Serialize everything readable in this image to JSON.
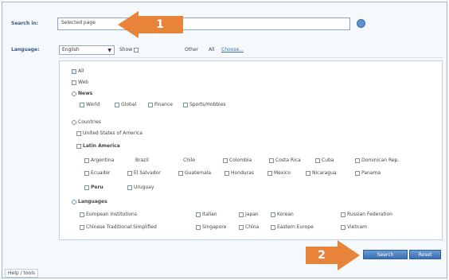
{
  "search": {
    "label": "Search in:",
    "value": "Selected page"
  },
  "language": {
    "label": "Language:",
    "selected": "English",
    "checkbox_label": "Show",
    "other_label": "Other",
    "other_value": "All",
    "other_link": "Choose..."
  },
  "options": {
    "all": "All",
    "web": "Web",
    "news": "News",
    "news_sub": [
      "World",
      "Global",
      "Finance",
      "Sports/Hobbies"
    ],
    "countries": "Countries",
    "usa": "United States of America",
    "latin": "Latin America",
    "latin_row1": [
      "Argentina",
      "Brazil",
      "Chile",
      "Colombia",
      "Costa Rica",
      "Cuba",
      "Dominican Rep."
    ],
    "latin_row2": [
      "Ecuador",
      "El Salvador",
      "Guatemala",
      "Honduras",
      "Mexico",
      "Nicaragua",
      "Panama"
    ],
    "latin_row3": [
      "Peru",
      "Uruguay"
    ],
    "languages": "Languages",
    "lang_row1": [
      "European Institutions",
      "Italian",
      "Japan",
      "Korean",
      "Russian Federation"
    ],
    "lang_row2": [
      "Chinese Traditional Simplified",
      "Singapore",
      "China",
      "Eastern Europe",
      "Vietnam"
    ]
  },
  "callouts": {
    "one": "1",
    "two": "2"
  },
  "buttons": {
    "search": "Search",
    "reset": "Reset"
  },
  "footer": {
    "label": "Help / tools"
  },
  "colors": {
    "accent": "#e8833a",
    "button": "#3c6fae",
    "label": "#3a5a86"
  }
}
